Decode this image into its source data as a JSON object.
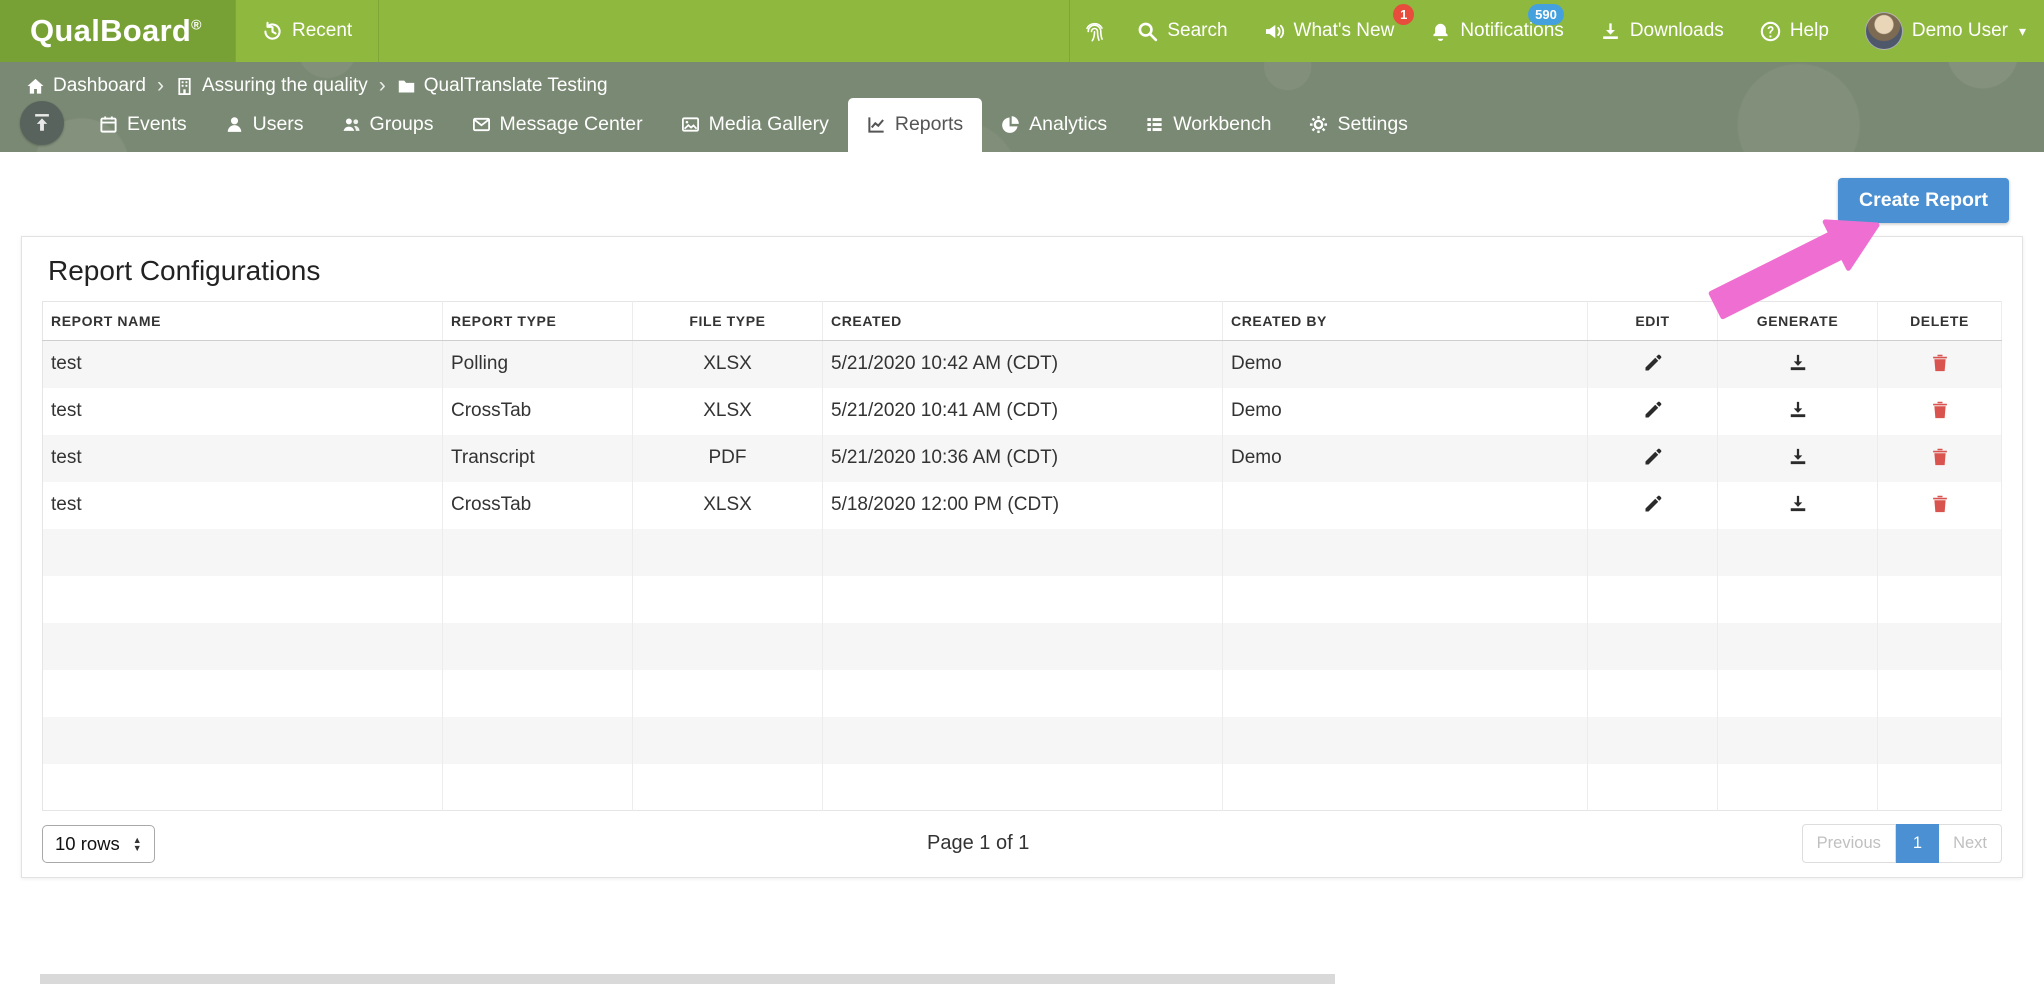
{
  "brand": {
    "name": "QualBoard",
    "registered": "®"
  },
  "topnav": {
    "recent": "Recent",
    "search": "Search",
    "whats_new": "What's New",
    "whats_new_badge": "1",
    "notifications": "Notifications",
    "notifications_badge": "590",
    "downloads": "Downloads",
    "help": "Help",
    "help_glyph": "?",
    "user_name": "Demo User",
    "user_caret": "▾"
  },
  "breadcrumb": {
    "separator": "›",
    "items": [
      {
        "label": "Dashboard",
        "icon": "home-icon"
      },
      {
        "label": "Assuring the quality",
        "icon": "building-icon"
      },
      {
        "label": "QualTranslate Testing",
        "icon": "folder-icon"
      }
    ]
  },
  "tabs": {
    "active": "Reports",
    "items": [
      {
        "label": "Events",
        "icon": "calendar-icon"
      },
      {
        "label": "Users",
        "icon": "user-icon"
      },
      {
        "label": "Groups",
        "icon": "users-icon"
      },
      {
        "label": "Message Center",
        "icon": "envelope-icon"
      },
      {
        "label": "Media Gallery",
        "icon": "photo-icon"
      },
      {
        "label": "Reports",
        "icon": "chart-line-icon"
      },
      {
        "label": "Analytics",
        "icon": "pie-chart-icon"
      },
      {
        "label": "Workbench",
        "icon": "list-icon"
      },
      {
        "label": "Settings",
        "icon": "gear-icon"
      }
    ]
  },
  "page": {
    "create_button": "Create Report",
    "title": "Report Configurations"
  },
  "table": {
    "headers": [
      "REPORT NAME",
      "REPORT TYPE",
      "FILE TYPE",
      "CREATED",
      "CREATED BY",
      "EDIT",
      "GENERATE",
      "DELETE"
    ],
    "rows": [
      {
        "name": "test",
        "type": "Polling",
        "file_type": "XLSX",
        "created": "5/21/2020 10:42 AM (CDT)",
        "created_by": "Demo"
      },
      {
        "name": "test",
        "type": "CrossTab",
        "file_type": "XLSX",
        "created": "5/21/2020 10:41 AM (CDT)",
        "created_by": "Demo"
      },
      {
        "name": "test",
        "type": "Transcript",
        "file_type": "PDF",
        "created": "5/21/2020 10:36 AM (CDT)",
        "created_by": "Demo"
      },
      {
        "name": "test",
        "type": "CrossTab",
        "file_type": "XLSX",
        "created": "5/18/2020 12:00 PM (CDT)",
        "created_by": ""
      }
    ],
    "empty_row_count": 6
  },
  "pager": {
    "rows_select": "10 rows",
    "select_up": "▲",
    "select_down": "▼",
    "page_info": "Page 1 of 1",
    "previous": "Previous",
    "current_page": "1",
    "next": "Next"
  },
  "colors": {
    "topbar_green": "#8eb93e",
    "logo_green": "#78a135",
    "subheader_olive": "#7a8973",
    "accent_blue": "#4a90d2",
    "badge_red": "#e74c3c",
    "badge_blue": "#45a1dd",
    "delete_red": "#d9534f",
    "annotation_pink": "#ef6ed2",
    "row_stripe": "#f6f6f6"
  }
}
